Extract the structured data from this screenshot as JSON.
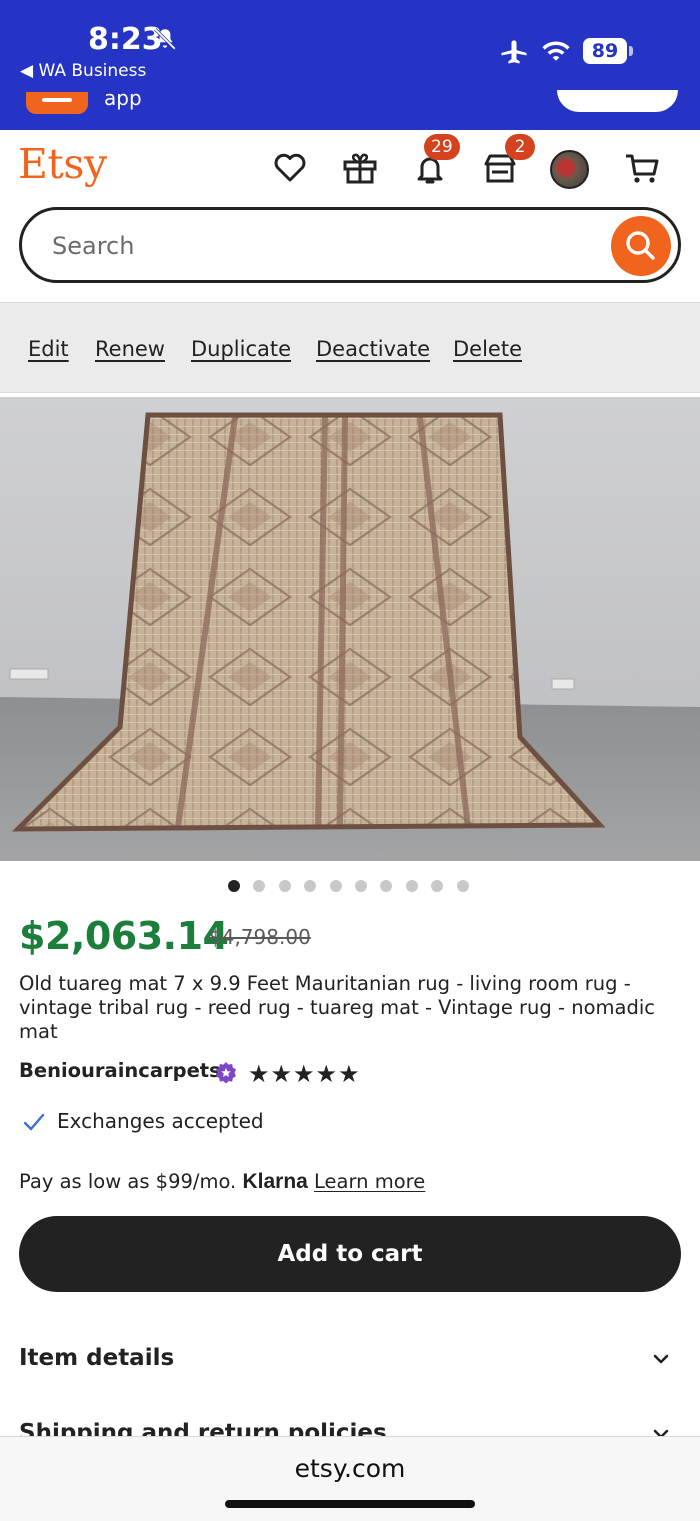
{
  "status_bar": {
    "time": "8:23",
    "back_label": "◀ WA Business",
    "battery": "89",
    "banner_text": "app"
  },
  "header": {
    "logo": "Etsy",
    "notifications_count": "29",
    "seller_updates_count": "2"
  },
  "search": {
    "placeholder": "Search"
  },
  "owner_actions": [
    "Edit",
    "Renew",
    "Duplicate",
    "Deactivate",
    "Delete"
  ],
  "carousel": {
    "total": 10,
    "active_index": 0
  },
  "listing": {
    "price": "$2,063.14",
    "original_price": "$4,798.00",
    "title": "Old tuareg mat 7 x 9.9 Feet Mauritanian rug - living room rug - vintage tribal rug - reed rug - tuareg mat - Vintage rug - nomadic mat",
    "shop_name": "Beniouraincarpets",
    "rating_stars": "★★★★★",
    "exchanges": "Exchanges accepted",
    "pay_text": "Pay as low as $99/mo.",
    "klarna": "Klarna",
    "learn_more": "Learn more",
    "add_to_cart": "Add to cart"
  },
  "sections": {
    "item_details": "Item details",
    "shipping": "Shipping and return policies"
  },
  "browser": {
    "url": "etsy.com"
  },
  "colors": {
    "status_bar": "#2534c4",
    "etsy_orange": "#f1641e",
    "price_green": "#1b7f3b",
    "badge_red": "#d5421f"
  }
}
